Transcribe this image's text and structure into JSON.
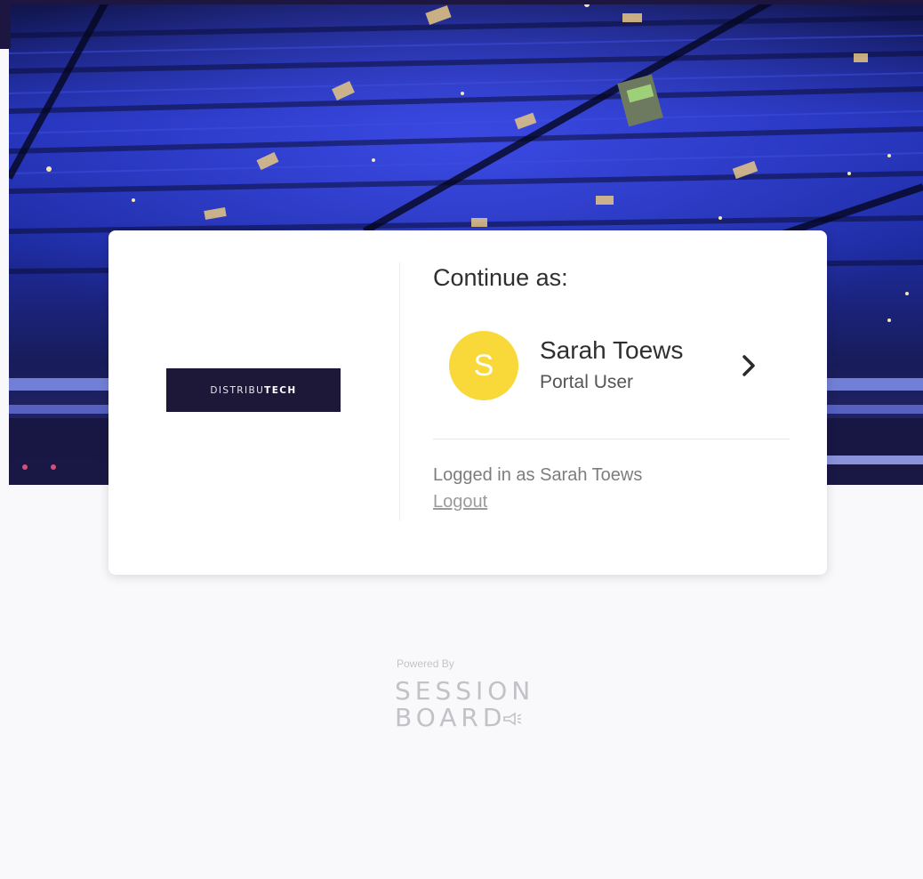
{
  "card": {
    "logo_text_light": "DISTRIBU",
    "logo_text_bold": "TECH",
    "continue_title": "Continue as:",
    "account": {
      "avatar_initial": "S",
      "name": "Sarah Toews",
      "role": "Portal User"
    },
    "logged_in_text": "Logged in as Sarah Toews",
    "logout_label": "Logout"
  },
  "footer": {
    "powered_by": "Powered By",
    "brand_line1": "SESSION",
    "brand_line2": "BOARD"
  },
  "colors": {
    "avatar_bg": "#f9d93a",
    "logo_bg": "#1d1838",
    "hero_blue": "#2a35c8",
    "page_bg": "#f9f9fb"
  }
}
